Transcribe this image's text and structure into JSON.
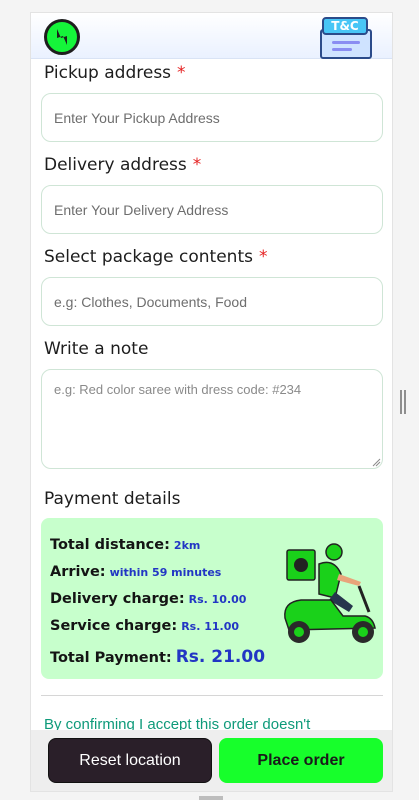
{
  "header": {
    "logo_icon": "lightning-bolt-icon",
    "tc_badge": "T&C"
  },
  "form": {
    "pickup": {
      "label": "Pickup address",
      "required_mark": "*",
      "placeholder": "Enter Your Pickup Address"
    },
    "delivery": {
      "label": "Delivery address",
      "required_mark": "*",
      "placeholder": "Enter Your Delivery Address"
    },
    "contents": {
      "label": "Select package contents",
      "required_mark": "*",
      "placeholder": "e.g: Clothes, Documents, Food"
    },
    "note": {
      "label": "Write a note",
      "placeholder": "e.g: Red color saree with dress code: #234"
    }
  },
  "payment": {
    "title": "Payment details",
    "rows": [
      {
        "label": "Total distance:",
        "value": "2km"
      },
      {
        "label": "Arrive:",
        "value": "within 59 minutes"
      },
      {
        "label": "Delivery charge:",
        "value": "Rs. 10.00"
      },
      {
        "label": "Service charge:",
        "value": "Rs. 11.00"
      }
    ],
    "total": {
      "label": "Total Payment:",
      "value": "Rs. 21.00"
    }
  },
  "terms_text": "By confirming I accept this order doesn't",
  "footer": {
    "reset_label": "Reset location",
    "place_label": "Place order"
  },
  "colors": {
    "accent_green": "#17ff2b",
    "payment_bg": "#c7ffcc",
    "value_blue": "#2236c4",
    "required_red": "#e52222",
    "terms_teal": "#0e9a7a"
  }
}
